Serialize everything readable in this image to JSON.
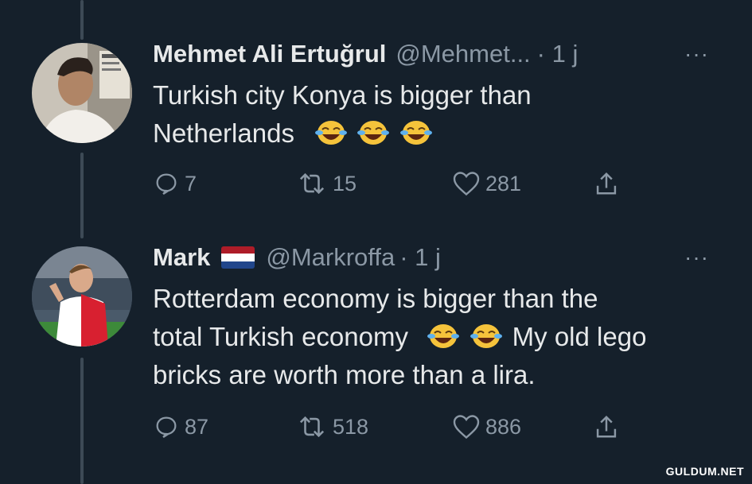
{
  "tweets": [
    {
      "name": "Mehmet Ali Ertuğrul",
      "handle": "@Mehmet...",
      "time": "· 1 j",
      "text_line1": "Turkish city Konya is bigger than",
      "text_line2": "Netherlands",
      "emoji": [
        "laughing-crying-emoji",
        "laughing-crying-emoji",
        "laughing-crying-emoji"
      ],
      "replies": "7",
      "retweets": "15",
      "likes": "281"
    },
    {
      "name": "Mark",
      "flag": "netherlands-flag",
      "handle": "@Markroffa",
      "time": "· 1 j",
      "text_line1": "Rotterdam economy is bigger than the",
      "text_line2a": "total Turkish economy",
      "text_line2b": "My old lego",
      "text_line3": "bricks are worth more than a lira.",
      "emoji": [
        "laughing-crying-emoji",
        "laughing-crying-emoji"
      ],
      "replies": "87",
      "retweets": "518",
      "likes": "886"
    }
  ],
  "more_icon": "···",
  "watermark": "GULDUM.NET",
  "colors": {
    "background": "#15202b",
    "text": "#e7e9ea",
    "muted": "#8b98a5",
    "thread_line": "#3d4a56"
  }
}
